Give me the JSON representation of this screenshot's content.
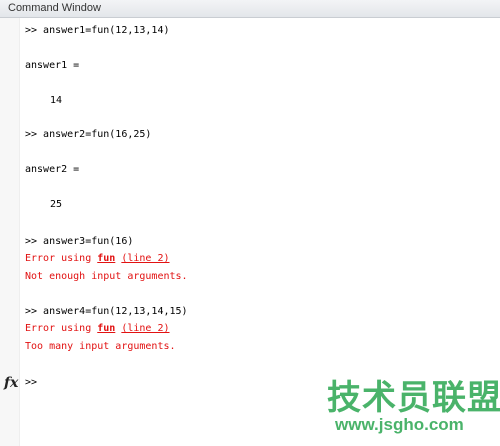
{
  "window": {
    "title": "Command Window"
  },
  "lines": {
    "cmd1": ">> answer1=fun(12,13,14)",
    "var1": "answer1 =",
    "val1": "14",
    "cmd2": ">> answer2=fun(16,25)",
    "var2": "answer2 =",
    "val2": "25",
    "cmd3": ">> answer3=fun(16)",
    "err3_prefix": "Error using ",
    "err3_func": "fun",
    "err3_line": "(line 2)",
    "err3_msg": "Not enough input arguments.",
    "cmd4": ">> answer4=fun(12,13,14,15)",
    "err4_prefix": "Error using ",
    "err4_func": "fun",
    "err4_line": "(line 2)",
    "err4_msg": "Too many input arguments."
  },
  "prompt": {
    "fx": "fx",
    "symbol": ">>",
    "value": ""
  },
  "watermark": {
    "cn": "技术员联盟",
    "url": "www.jsgho.com"
  },
  "colors": {
    "error": "#e21212",
    "watermark": "#4ab36a"
  }
}
